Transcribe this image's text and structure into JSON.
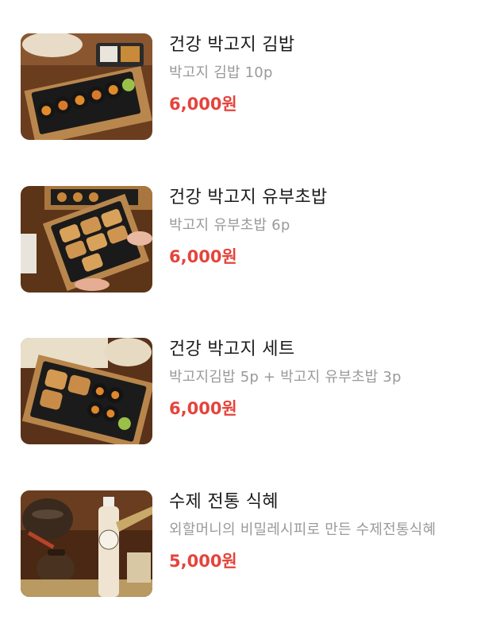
{
  "menu": {
    "items": [
      {
        "name": "건강 박고지 김밥",
        "description": "박고지 김밥 10p",
        "price": "6,000원",
        "thumbnail": "kimbap-platter-photo"
      },
      {
        "name": "건강 박고지 유부초밥",
        "description": "박고지 유부초밥 6p",
        "price": "6,000원",
        "thumbnail": "yubuchobap-platter-photo"
      },
      {
        "name": "건강 박고지 세트",
        "description": "박고지김밥 5p + 박고지 유부초밥 3p",
        "price": "6,000원",
        "thumbnail": "set-platter-photo"
      },
      {
        "name": "수제 전통 식혜",
        "description": "외할머니의 비밀레시피로 만든 수제전통식혜",
        "price": "5,000원",
        "thumbnail": "sikhye-bottle-photo"
      }
    ]
  },
  "colors": {
    "price": "#e5443c",
    "name": "#1b1b1b",
    "description": "#9a9a9a"
  }
}
